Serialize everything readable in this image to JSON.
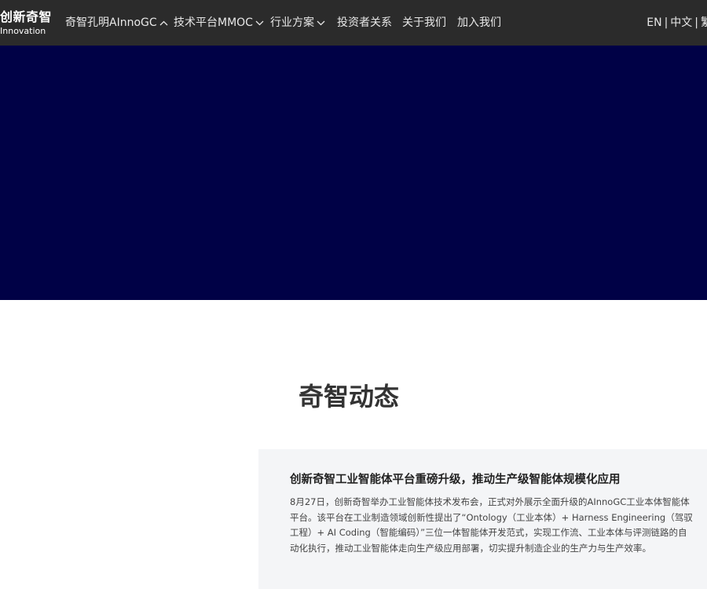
{
  "header": {
    "logo": {
      "cn": "创新奇智",
      "en": "Innovation"
    },
    "nav": [
      {
        "label": "奇智孔明AInnoGC",
        "chevron": "up"
      },
      {
        "label": "技术平台MMOC",
        "chevron": "down"
      },
      {
        "label": "行业方案",
        "chevron": "down"
      },
      {
        "label": "投资者关系",
        "chevron": ""
      },
      {
        "label": "关于我们",
        "chevron": ""
      },
      {
        "label": "加入我们",
        "chevron": ""
      }
    ],
    "languages": {
      "en": "EN",
      "zh": "中文",
      "separator": "|",
      "extra": "繁"
    }
  },
  "hero": {
    "background_color": "#000146"
  },
  "news_section": {
    "title": "奇智动态",
    "card": {
      "headline": "创新奇智工业智能体平台重磅升级，推动生产级智能体规模化应用",
      "summary": "8月27日，创新奇智举办工业智能体技术发布会，正式对外展示全面升级的AInnoGC工业本体智能体平台。该平台在工业制造领域创新性提出了“Ontology（工业本体）+ Harness Engineering（驾驭工程）+ AI Coding（智能编码）”三位一体智能体开发范式，实现工作流、工业本体与评测链路的自动化执行，推动工业智能体走向生产级应用部署，切实提升制造企业的生产力与生产效率。"
    }
  },
  "colors": {
    "navbar": "#2b2b2b",
    "card_background": "#f4f5f7",
    "nav_text": "#e8e8e8"
  }
}
